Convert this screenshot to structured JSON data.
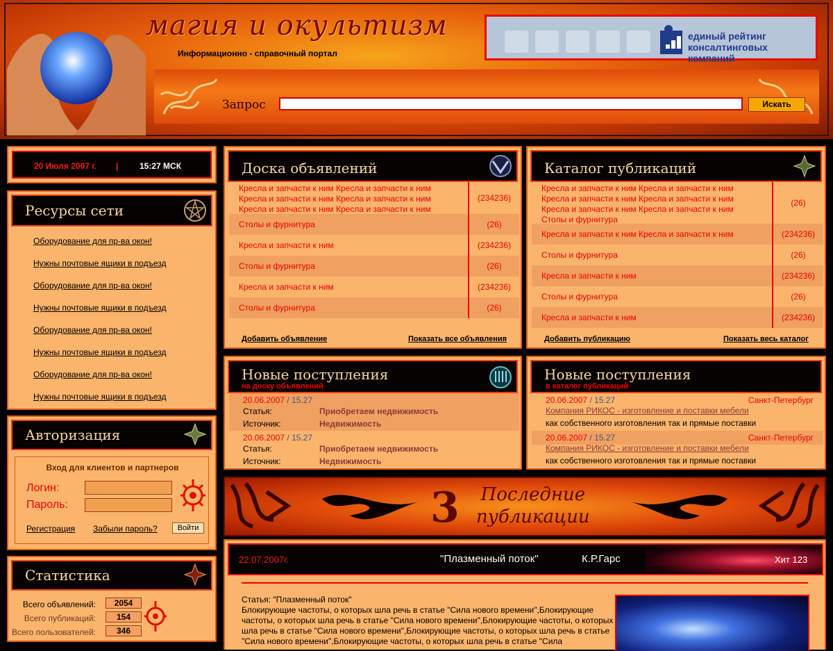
{
  "header": {
    "logo": "магия и окультизм",
    "subtitle": "Информационно - справочный портал",
    "rating_line1": "единый рейтинг",
    "rating_line2": "консалтинговых компаний",
    "search_label": "Запрос",
    "search_value": "",
    "search_button": "Искать"
  },
  "datebar": {
    "date": "20 Июля 2007 г.",
    "sep": "|",
    "time": "15:27 МСК"
  },
  "resources": {
    "title": "Ресурсы сети",
    "links": [
      "Оборудование для пр-ва окон!",
      "Нужны почтовые ящики в подъезд",
      "Оборудование для пр-ва окон!",
      "Нужны почтовые ящики в подъезд",
      "Оборудование для пр-ва окон!",
      "Нужны почтовые ящики в подъезд",
      "Оборудование для пр-ва окон!",
      "Нужны почтовые ящики в подъезд"
    ]
  },
  "auth": {
    "title": "Авторизация",
    "heading": "Вход для клиентов и партнеров",
    "login_label": "Логин:",
    "password_label": "Пароль:",
    "register": "Регистрация",
    "forgot": "Забыли пароль?",
    "submit": "Войти"
  },
  "stats": {
    "title": "Статистика",
    "ads_label": "Всего объявлений:",
    "ads": "2054",
    "pubs_label": "Всего публикаций:",
    "pubs": "154",
    "users_label": "Всего пользователей:",
    "users": "346"
  },
  "board": {
    "title": "Доска объявлений",
    "rows": [
      {
        "text": "Кресла и запчасти к ним Кресла и запчасти к ним Кресла и запчасти к ним Кресла и запчасти к ним Кресла и запчасти к ним Кресла и запчасти к ним",
        "count": "(234236)"
      },
      {
        "text": "Столы и фурнитура",
        "count": "(26)"
      },
      {
        "text": "Кресла и запчасти к ним",
        "count": "(234236)"
      },
      {
        "text": "Столы и фурнитура",
        "count": "(26)"
      },
      {
        "text": "Кресла и запчасти к ним",
        "count": "(234236)"
      },
      {
        "text": "Столы и фурнитура",
        "count": "(26)"
      }
    ],
    "add": "Добавить объявление",
    "all": "Показать все объявления"
  },
  "catalog": {
    "title": "Каталог публикаций",
    "rows": [
      {
        "text": "Кресла и запчасти к ним Кресла и запчасти к ним Кресла и запчасти к ним Кресла и запчасти к ним Кресла и запчасти к ним Кресла и запчасти к ним Столы и фурнитура",
        "count": "(26)"
      },
      {
        "text": "Кресла и запчасти к ним Кресла и запчасти к ним",
        "count": "(234236)"
      },
      {
        "text": "Столы и фурнитура",
        "count": "(26)"
      },
      {
        "text": "Кресла и запчасти к ним",
        "count": "(234236)"
      },
      {
        "text": "Столы и фурнитура",
        "count": "(26)"
      },
      {
        "text": "Кресла и запчасти к ним",
        "count": "(234236)"
      }
    ],
    "add": "Добавить публикацию",
    "all": "Показать весь каталог"
  },
  "new_board": {
    "title": "Новые поступления",
    "subtitle": "на доску объявлений",
    "items": [
      {
        "date": "20.06.2007",
        "sep": "/",
        "time": "15.27",
        "k1": "Статья:",
        "v1": "Приобретаем недвижимость",
        "k2": "Источник:",
        "v2": "Недвижимость"
      },
      {
        "date": "20.06.2007",
        "sep": "/",
        "time": "15.27",
        "k1": "Статья:",
        "v1": "Приобретаем недвижимость",
        "k2": "Источник:",
        "v2": "Недвижимость"
      }
    ]
  },
  "new_catalog": {
    "title": "Новые поступления",
    "subtitle": "в каталог публикаций",
    "items": [
      {
        "date": "20.06.2007",
        "sep": "/",
        "time": "15.27",
        "city": "Санкт-Петербург",
        "company": "Компания РИКОС - изготовление и поставки мебели",
        "desc": "как собственного изготовления так и прямые поставки"
      },
      {
        "date": "20.06.2007",
        "sep": "/",
        "time": "15.27",
        "city": "Санкт-Петербург",
        "company": "Компания РИКОС - изготовление и поставки мебели",
        "desc": "как собственного изготовления так и прямые поставки"
      }
    ]
  },
  "banner": {
    "number": "3",
    "line1": "Последние",
    "line2": "публикации"
  },
  "article": {
    "date": "22.07.2007г.",
    "title": "\"Плазменный поток\"",
    "author": "К.Р.Гарс",
    "hits": "Хит 123",
    "heading": "Статья: \"Плазменный поток\"",
    "body": "Блокирующие частоты, о которых шла речь в статье \"Сила нового времени\",Блокирующие частоты, о которых шла речь в статье \"Сила нового времени\",Блокирующие частоты, о которых шла речь в статье \"Сила нового времени\",Блокирующие частоты, о которых шла речь в статье \"Сила нового времени\",Блокирующие частоты, о которых шла речь в статье \"Сила"
  }
}
